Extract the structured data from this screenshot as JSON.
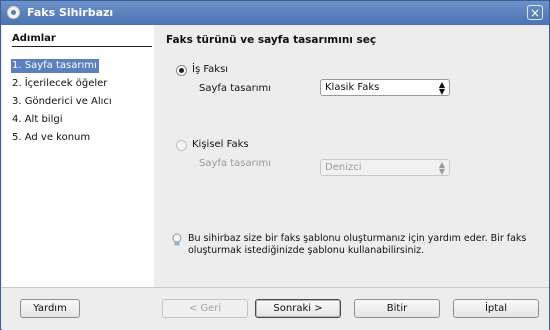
{
  "window": {
    "title": "Faks Sihirbazı"
  },
  "sidebar": {
    "heading": "Adımlar",
    "steps": [
      {
        "label": "1. Sayfa tasarımı",
        "active": true
      },
      {
        "label": "2. İçerilecek öğeler",
        "active": false
      },
      {
        "label": "3. Gönderici ve Alıcı",
        "active": false
      },
      {
        "label": "4. Alt bilgi",
        "active": false
      },
      {
        "label": "5. Ad ve konum",
        "active": false
      }
    ]
  },
  "main": {
    "heading": "Faks türünü ve sayfa tasarımını seç",
    "business_fax": {
      "label": "İş Faksı",
      "checked": true,
      "layout_label": "Sayfa tasarımı",
      "layout_value": "Klasik Faks"
    },
    "personal_fax": {
      "label": "Kişisel Faks",
      "checked": false,
      "layout_label": "Sayfa tasarımı",
      "layout_value": "Denizci"
    },
    "hint": "Bu sihirbaz size bir faks şablonu oluşturmanız için yardım eder. Bir faks oluşturmak istediğinizde şablonu kullanabilirsiniz."
  },
  "footer": {
    "help": "Yardım",
    "back": "< Geri",
    "next": "Sonraki >",
    "finish": "Bitir",
    "cancel": "İptal"
  }
}
